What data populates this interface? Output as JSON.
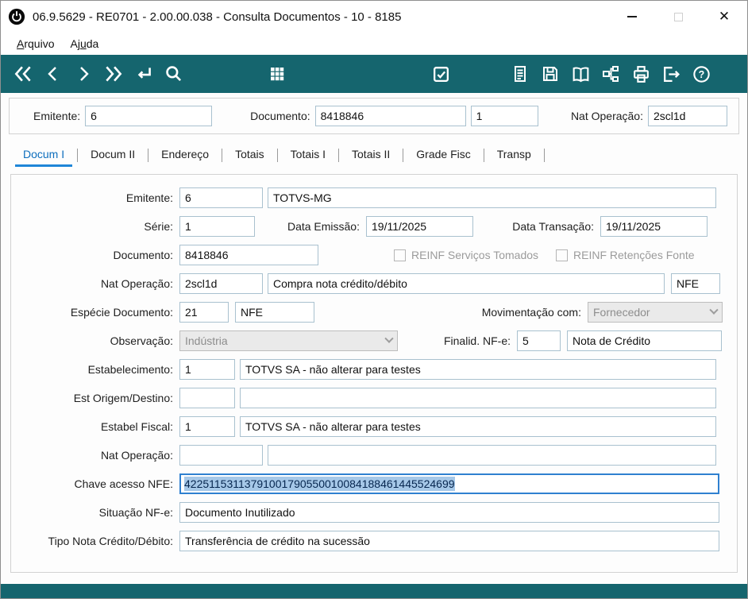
{
  "window": {
    "title": "06.9.5629 - RE0701 - 2.00.00.038 - Consulta Documentos - 10 - 8185",
    "controls": {
      "close_glyph": "✕"
    }
  },
  "menu": {
    "items": [
      {
        "pre": "",
        "accel": "A",
        "rest": "rquivo"
      },
      {
        "pre": "Aj",
        "accel": "u",
        "rest": "da"
      }
    ]
  },
  "toolbar": {
    "icons": [
      "first-icon",
      "prev-icon",
      "next-icon",
      "last-icon",
      "go-icon",
      "search-icon",
      "grid-icon",
      "confirm-icon",
      "report-icon",
      "save-icon",
      "book-icon",
      "tree-icon",
      "print-icon",
      "exit-icon",
      "help-icon"
    ]
  },
  "header": {
    "emitente": {
      "label": "Emitente:",
      "value": "6"
    },
    "documento": {
      "label": "Documento:",
      "value": "8418846",
      "seq": "1"
    },
    "nat_operacao": {
      "label": "Nat Operação:",
      "value": "2scl1d"
    }
  },
  "tabs": [
    {
      "label": "Docum I",
      "active": true
    },
    {
      "label": "Docum II",
      "active": false
    },
    {
      "label": "Endereço",
      "active": false
    },
    {
      "label": "Totais",
      "active": false
    },
    {
      "label": "Totais I",
      "active": false
    },
    {
      "label": "Totais II",
      "active": false
    },
    {
      "label": "Grade Fisc",
      "active": false
    },
    {
      "label": "Transp",
      "active": false
    }
  ],
  "form": {
    "emitente": {
      "label": "Emitente:",
      "code": "6",
      "desc": "TOTVS-MG"
    },
    "serie": {
      "label": "Série:",
      "value": "1"
    },
    "data_emissao": {
      "label": "Data Emissão:",
      "value": "19/11/2025"
    },
    "data_transacao": {
      "label": "Data Transação:",
      "value": "19/11/2025"
    },
    "documento": {
      "label": "Documento:",
      "value": "8418846"
    },
    "reinf_servicos": {
      "label": "REINF Serviços Tomados",
      "checked": false
    },
    "reinf_retencoes": {
      "label": "REINF Retenções Fonte",
      "checked": false
    },
    "nat_operacao": {
      "label": "Nat Operação:",
      "code": "2scl1d",
      "desc": "Compra nota crédito/débito",
      "tipo": "NFE"
    },
    "especie_documento": {
      "label": "Espécie Documento:",
      "code": "21",
      "desc": "NFE"
    },
    "movimentacao_com": {
      "label": "Movimentação com:",
      "value": "Fornecedor"
    },
    "observacao": {
      "label": "Observação:",
      "value": "Indústria"
    },
    "finalidade_nfe": {
      "label": "Finalid. NF-e:",
      "code": "5",
      "desc": "Nota de Crédito"
    },
    "estabelecimento": {
      "label": "Estabelecimento:",
      "code": "1",
      "desc": "TOTVS SA - não alterar para testes"
    },
    "est_origem_destino": {
      "label": "Est Origem/Destino:",
      "code": "",
      "desc": ""
    },
    "estabel_fiscal": {
      "label": "Estabel Fiscal:",
      "code": "1",
      "desc": "TOTVS SA - não alterar para testes"
    },
    "nat_operacao_2": {
      "label": "Nat Operação:",
      "code": "",
      "desc": ""
    },
    "chave_acesso": {
      "label": "Chave acesso NFE:",
      "value": "42251153113791001790550010084188461445524699"
    },
    "situacao_nfe": {
      "label": "Situação NF-e:",
      "value": "Documento Inutilizado"
    },
    "tipo_nota": {
      "label": "Tipo Nota Crédito/Débito:",
      "value": "Transferência de crédito na sucessão"
    }
  },
  "colors": {
    "toolbar_teal": "#15656e",
    "tab_active": "#0d6ebd",
    "focus_border": "#2f80d0",
    "selection_bg": "#a6c8e8"
  }
}
